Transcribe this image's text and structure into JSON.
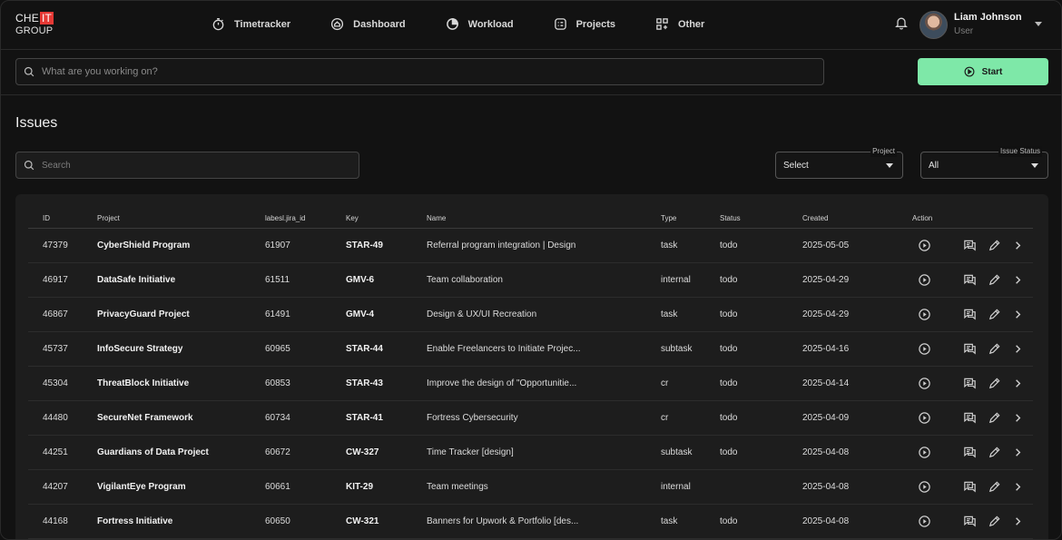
{
  "app": {
    "logo_top": "CHE",
    "logo_badge": "IT",
    "logo_bottom": "GROUP"
  },
  "nav": [
    {
      "label": "Timetracker",
      "icon": "timer-icon"
    },
    {
      "label": "Dashboard",
      "icon": "dashboard-icon"
    },
    {
      "label": "Workload",
      "icon": "pie-icon"
    },
    {
      "label": "Projects",
      "icon": "projects-icon"
    },
    {
      "label": "Other",
      "icon": "grid-plus-icon"
    }
  ],
  "user": {
    "name": "Liam Johnson",
    "role": "User"
  },
  "tracker": {
    "placeholder": "What are you working on?",
    "start_label": "Start"
  },
  "page": {
    "title": "Issues"
  },
  "filters": {
    "search_placeholder": "Search",
    "project_label": "Project",
    "project_value": "Select",
    "status_label": "Issue Status",
    "status_value": "All"
  },
  "colors": {
    "accent": "#7ee8a8",
    "logo_badge": "#e53935",
    "background": "#121212",
    "panel": "#1d1d1d"
  },
  "table": {
    "headers": [
      "ID",
      "Project",
      "labesl.jira_id",
      "Key",
      "Name",
      "Type",
      "Status",
      "Created",
      "Action"
    ],
    "rows": [
      {
        "id": "47379",
        "project": "CyberShield Program",
        "jira_id": "61907",
        "key": "STAR-49",
        "name": "Referral program integration | Design",
        "type": "task",
        "status": "todo",
        "created": "2025-05-05"
      },
      {
        "id": "46917",
        "project": "DataSafe Initiative",
        "jira_id": "61511",
        "key": "GMV-6",
        "name": "Team collaboration",
        "type": "internal",
        "status": "todo",
        "created": "2025-04-29"
      },
      {
        "id": "46867",
        "project": "PrivacyGuard Project",
        "jira_id": "61491",
        "key": "GMV-4",
        "name": "Design & UX/UI Recreation",
        "type": "task",
        "status": "todo",
        "created": "2025-04-29"
      },
      {
        "id": "45737",
        "project": "InfoSecure Strategy",
        "jira_id": "60965",
        "key": "STAR-44",
        "name": "Enable Freelancers to Initiate Projec...",
        "type": "subtask",
        "status": "todo",
        "created": "2025-04-16"
      },
      {
        "id": "45304",
        "project": "ThreatBlock Initiative",
        "jira_id": "60853",
        "key": "STAR-43",
        "name": "Improve the design of \"Opportunitie...",
        "type": "cr",
        "status": "todo",
        "created": "2025-04-14"
      },
      {
        "id": "44480",
        "project": "SecureNet Framework",
        "jira_id": "60734",
        "key": "STAR-41",
        "name": "Fortress Cybersecurity",
        "type": "cr",
        "status": "todo",
        "created": "2025-04-09"
      },
      {
        "id": "44251",
        "project": "Guardians of Data Project",
        "jira_id": "60672",
        "key": "CW-327",
        "name": "Time Tracker [design]",
        "type": "subtask",
        "status": "todo",
        "created": "2025-04-08"
      },
      {
        "id": "44207",
        "project": "VigilantEye Program",
        "jira_id": "60661",
        "key": "KIT-29",
        "name": "Team meetings",
        "type": "internal",
        "status": "",
        "created": "2025-04-08"
      },
      {
        "id": "44168",
        "project": "Fortress Initiative",
        "jira_id": "60650",
        "key": "CW-321",
        "name": "Banners for Upwork & Portfolio [des...",
        "type": "task",
        "status": "todo",
        "created": "2025-04-08"
      }
    ]
  }
}
